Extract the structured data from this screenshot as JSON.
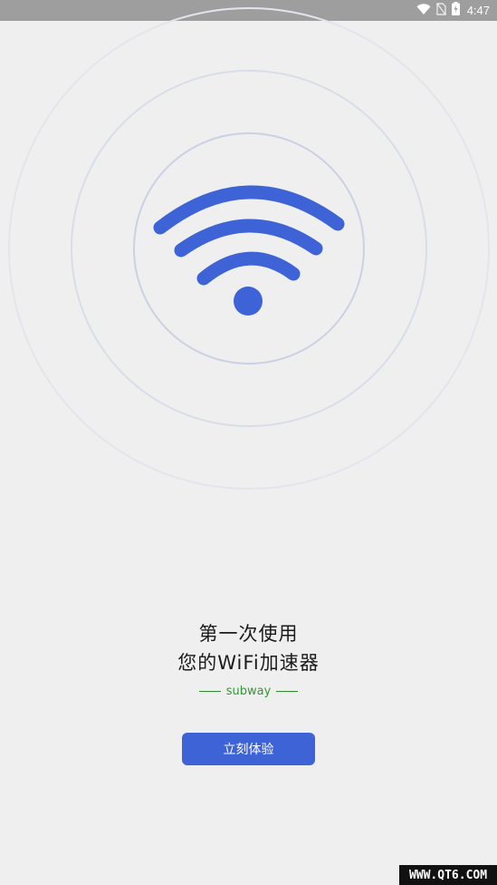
{
  "status_bar": {
    "time": "4:47",
    "icons": [
      "wifi-icon",
      "no-sim-icon",
      "battery-charging-icon"
    ]
  },
  "hero": {
    "icon": "wifi-icon",
    "accent_color": "#3d63d6"
  },
  "intro": {
    "title_line_1": "第一次使用",
    "title_line_2": "您的WiFi加速器",
    "tagline": "subway"
  },
  "actions": {
    "start_label": "立刻体验"
  },
  "watermark": {
    "text": "WWW.QT6.COM"
  }
}
